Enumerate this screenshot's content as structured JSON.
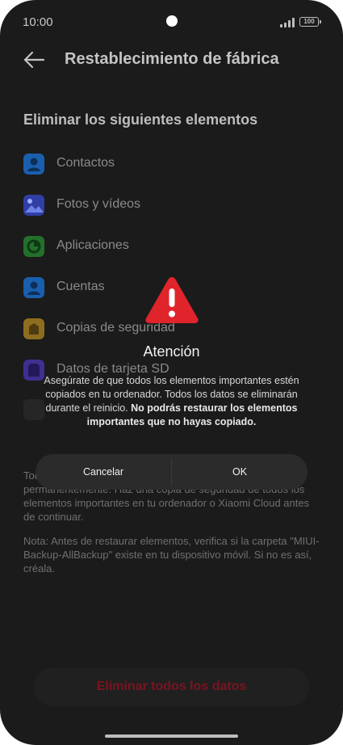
{
  "status": {
    "time": "10:00",
    "battery": "100"
  },
  "header": {
    "title": "Restablecimiento de fábrica"
  },
  "section": {
    "title": "Eliminar los siguientes elementos"
  },
  "items": [
    {
      "label": "Contactos",
      "icon": "contacts-icon",
      "color": "#1f73d6"
    },
    {
      "label": "Fotos y vídeos",
      "icon": "photos-icon",
      "color": "#3d4fd1"
    },
    {
      "label": "Aplicaciones",
      "icon": "apps-icon",
      "color": "#2f8c38"
    },
    {
      "label": "Cuentas",
      "icon": "accounts-icon",
      "color": "#1f73d6"
    },
    {
      "label": "Copias de seguridad",
      "icon": "backup-icon",
      "color": "#c79a2a"
    },
    {
      "label": "Datos de tarjeta SD",
      "icon": "sd-card-icon",
      "color": "#5a44c9"
    }
  ],
  "info": {
    "paragraph1": "Todos los elementos enumerados anteriormente se borrarán permanentemente. Haz una copia de seguridad de todos los elementos importantes en tu ordenador o Xiaomi Cloud antes de continuar.",
    "paragraph2": "Nota: Antes de restaurar elementos, verifica si la carpeta \"MIUI-Backup-AllBackup\" existe en tu dispositivo móvil. Si no es así, créala."
  },
  "bottom_button": {
    "label": "Eliminar todos los datos"
  },
  "dialog": {
    "title": "Atención",
    "message_plain": "Asegúrate de que todos los elementos importantes estén copiados en tu ordenador. Todos los datos se eliminarán durante el reinicio. ",
    "message_bold": "No podrás restaurar los elementos importantes que no hayas copiado.",
    "cancel_label": "Cancelar",
    "ok_label": "OK",
    "alert_color": "#e0242b"
  }
}
